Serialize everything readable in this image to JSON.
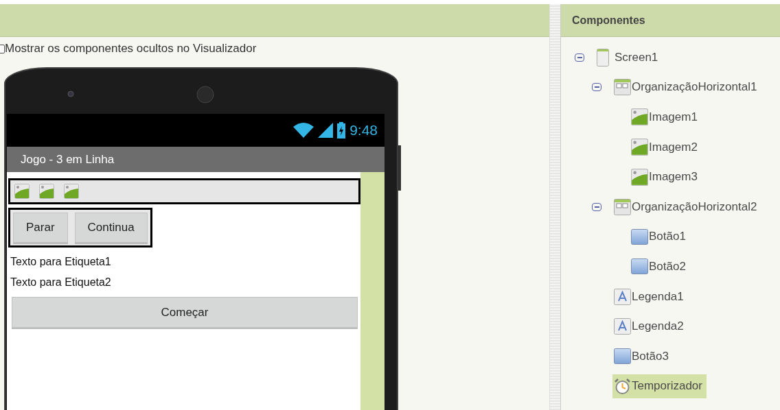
{
  "viewer": {
    "show_hidden": {
      "label": "Mostrar os componentes ocultos no Visualizador",
      "checked": false
    },
    "phone": {
      "time": "9:48",
      "title": "Jogo - 3 em Linha",
      "button_row": [
        {
          "label": "Parar"
        },
        {
          "label": "Continua"
        }
      ],
      "labels": [
        "Texto para Etiqueta1",
        "Texto para Etiqueta2"
      ],
      "main_button": "Começar"
    }
  },
  "components": {
    "title": "Componentes",
    "tree": [
      {
        "name": "Screen1",
        "kind": "screen",
        "expanded": true,
        "selected": false,
        "children": [
          {
            "name": "OrganizaçãoHorizontal1",
            "kind": "arrangement",
            "expanded": true,
            "selected": false,
            "children": [
              {
                "name": "Imagem1",
                "kind": "image",
                "selected": false
              },
              {
                "name": "Imagem2",
                "kind": "image",
                "selected": false
              },
              {
                "name": "Imagem3",
                "kind": "image",
                "selected": false
              }
            ]
          },
          {
            "name": "OrganizaçãoHorizontal2",
            "kind": "arrangement",
            "expanded": true,
            "selected": false,
            "children": [
              {
                "name": "Botão1",
                "kind": "button",
                "selected": false
              },
              {
                "name": "Botão2",
                "kind": "button",
                "selected": false
              }
            ]
          },
          {
            "name": "Legenda1",
            "kind": "label",
            "selected": false
          },
          {
            "name": "Legenda2",
            "kind": "label",
            "selected": false
          },
          {
            "name": "Botão3",
            "kind": "button",
            "selected": false
          },
          {
            "name": "Temporizador",
            "kind": "clock",
            "selected": true
          }
        ]
      }
    ]
  }
}
